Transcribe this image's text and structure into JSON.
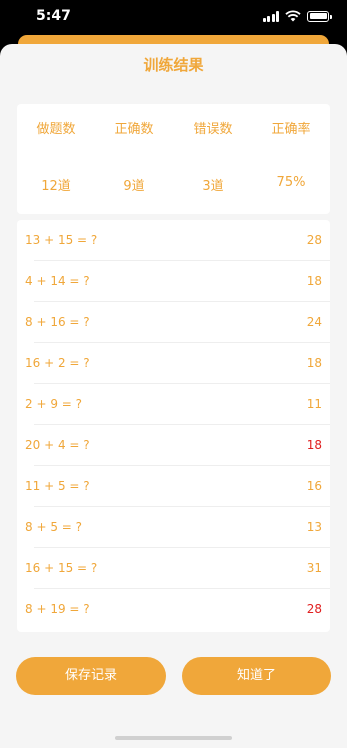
{
  "status_bar": {
    "time": "5:47"
  },
  "screen": {
    "title": "训练结果"
  },
  "stats": [
    {
      "label": "做题数",
      "value": "12道"
    },
    {
      "label": "正确数",
      "value": "9道"
    },
    {
      "label": "错误数",
      "value": "3道"
    },
    {
      "label": "正确率",
      "value": "75%"
    }
  ],
  "results": [
    {
      "question": "13 + 15 = ?",
      "answer": "28",
      "correct": true
    },
    {
      "question": "4 + 14 = ?",
      "answer": "18",
      "correct": true
    },
    {
      "question": "8 + 16 = ?",
      "answer": "24",
      "correct": true
    },
    {
      "question": "16 + 2 = ?",
      "answer": "18",
      "correct": true
    },
    {
      "question": "2 + 9 = ?",
      "answer": "11",
      "correct": true
    },
    {
      "question": "20 + 4 = ?",
      "answer": "18",
      "correct": false
    },
    {
      "question": "11 + 5 = ?",
      "answer": "16",
      "correct": true
    },
    {
      "question": "8 + 5 = ?",
      "answer": "13",
      "correct": true
    },
    {
      "question": "16 + 15 = ?",
      "answer": "31",
      "correct": true
    },
    {
      "question": "8 + 19 = ?",
      "answer": "28",
      "correct": false
    }
  ],
  "buttons": {
    "save": "保存记录",
    "ok": "知道了"
  },
  "colors": {
    "accent": "#f0a73a",
    "wrong": "#e02020",
    "background": "#f5f5f5"
  }
}
